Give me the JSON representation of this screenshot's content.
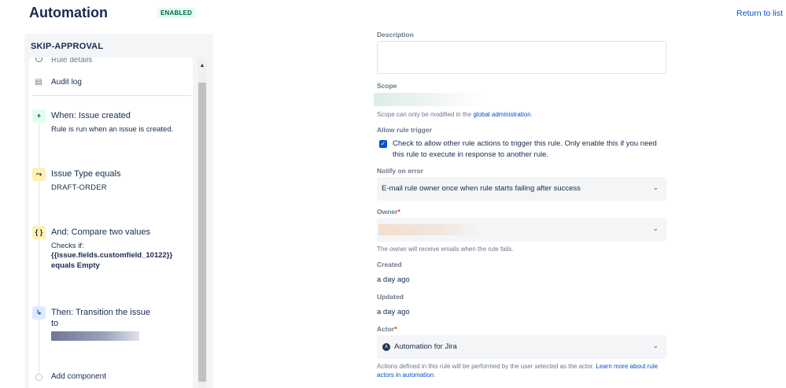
{
  "header": {
    "title": "Automation",
    "status_badge": "ENABLED",
    "return_link": "Return to list"
  },
  "sidebar": {
    "rule_name": "SKIP-APPROVAL",
    "rule_details": "Rule details",
    "audit_log": "Audit log",
    "steps": [
      {
        "icon": "+",
        "title": "When: Issue created",
        "sub": "Rule is run when an issue is created."
      },
      {
        "icon": "⤳",
        "title": "Issue Type equals",
        "sub": "DRAFT-ORDER"
      },
      {
        "icon": "{ }",
        "title": "And: Compare two values",
        "sub1": "Checks if:",
        "sub2": "{{issue.fields.customfield_10122}}",
        "sub3": "equals Empty"
      },
      {
        "icon": "↳",
        "title": "Then: Transition the issue",
        "sub": "to"
      }
    ],
    "add_component": "Add component"
  },
  "form": {
    "description_label": "Description",
    "scope_label": "Scope",
    "scope_help_prefix": "Scope can only be modified in the ",
    "scope_help_link": "global administration",
    "scope_help_suffix": ".",
    "allow_trigger_label": "Allow rule trigger",
    "allow_trigger_text": "Check to allow other rule actions to trigger this rule. Only enable this if you need this rule to execute in response to another rule.",
    "allow_trigger_checked": true,
    "notify_label": "Notify on error",
    "notify_value": "E-mail rule owner once when rule starts failing after success",
    "owner_label": "Owner",
    "owner_help": "The owner will receive emails when the rule fails.",
    "created_label": "Created",
    "created_value": "a day ago",
    "updated_label": "Updated",
    "updated_value": "a day ago",
    "actor_label": "Actor",
    "actor_value": "Automation for Jira",
    "actor_help_prefix": "Actions defined in this rule will be performed by the user selected as the actor. ",
    "actor_help_link": "Learn more about rule actors in automation",
    "actor_help_suffix": ".",
    "required_mark": "*"
  },
  "colors": {
    "accent": "#0052cc",
    "enabled_bg": "#e3fcef",
    "enabled_text": "#006644",
    "panel_bg": "#f4f5f7"
  }
}
